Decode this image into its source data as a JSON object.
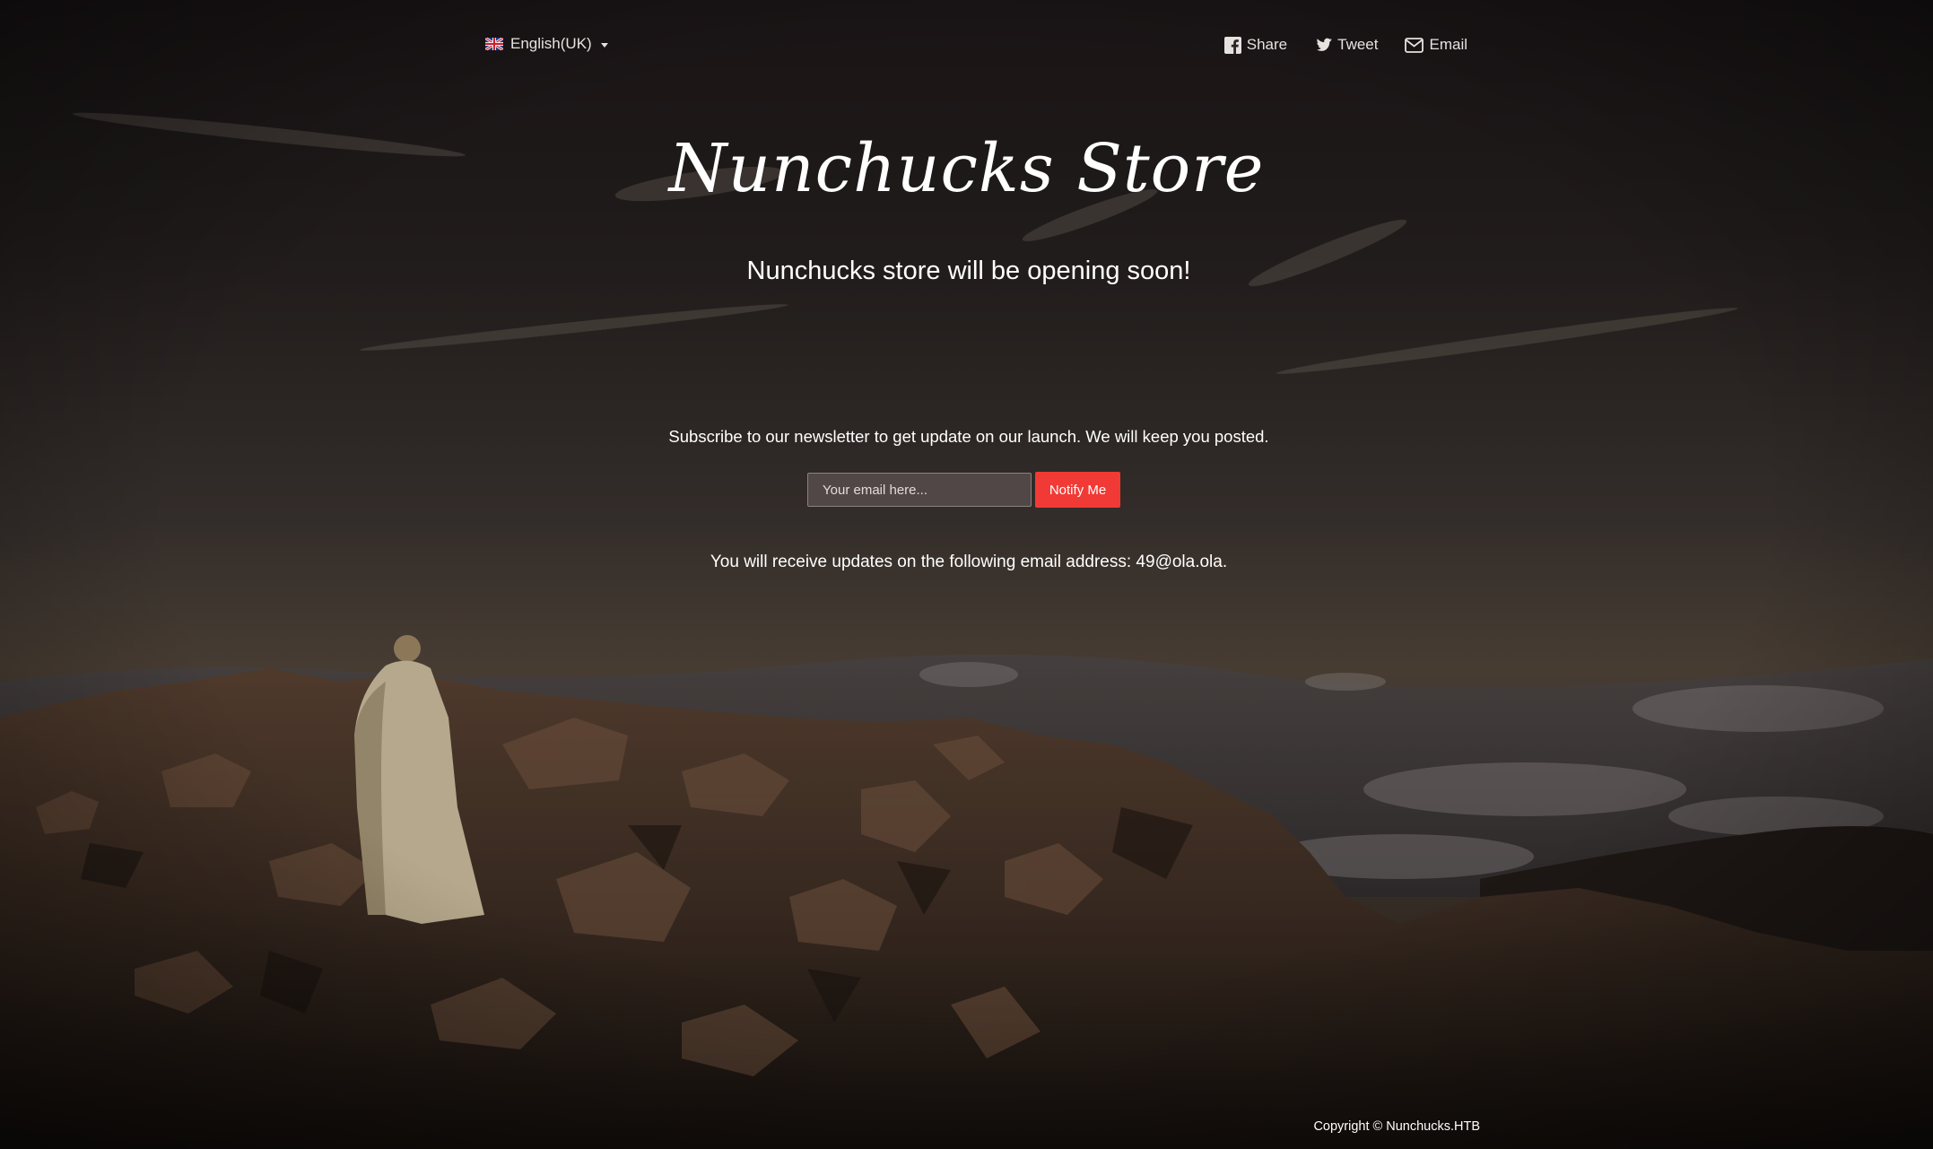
{
  "header": {
    "language": {
      "label": "English(UK)",
      "flag": "uk-flag-icon"
    },
    "social": [
      {
        "label": "Share",
        "icon": "facebook-icon"
      },
      {
        "label": "Tweet",
        "icon": "twitter-icon"
      },
      {
        "label": "Email",
        "icon": "envelope-icon"
      }
    ]
  },
  "hero": {
    "title": "Nunchucks Store",
    "subtitle": "Nunchucks store will be opening soon!"
  },
  "newsletter": {
    "text": "Subscribe to our newsletter to get update on our launch. We will keep you posted.",
    "email_placeholder": "Your email here...",
    "email_value": "",
    "button_label": "Notify Me",
    "confirmation": "You will receive updates on the following email address: 49@ola.ola."
  },
  "footer": {
    "copyright": "Copyright © Nunchucks.HTB"
  },
  "colors": {
    "accent": "#f13a35",
    "text": "#ffffff",
    "sky_top": "#1d1719",
    "sky_horizon": "#4f4238"
  }
}
